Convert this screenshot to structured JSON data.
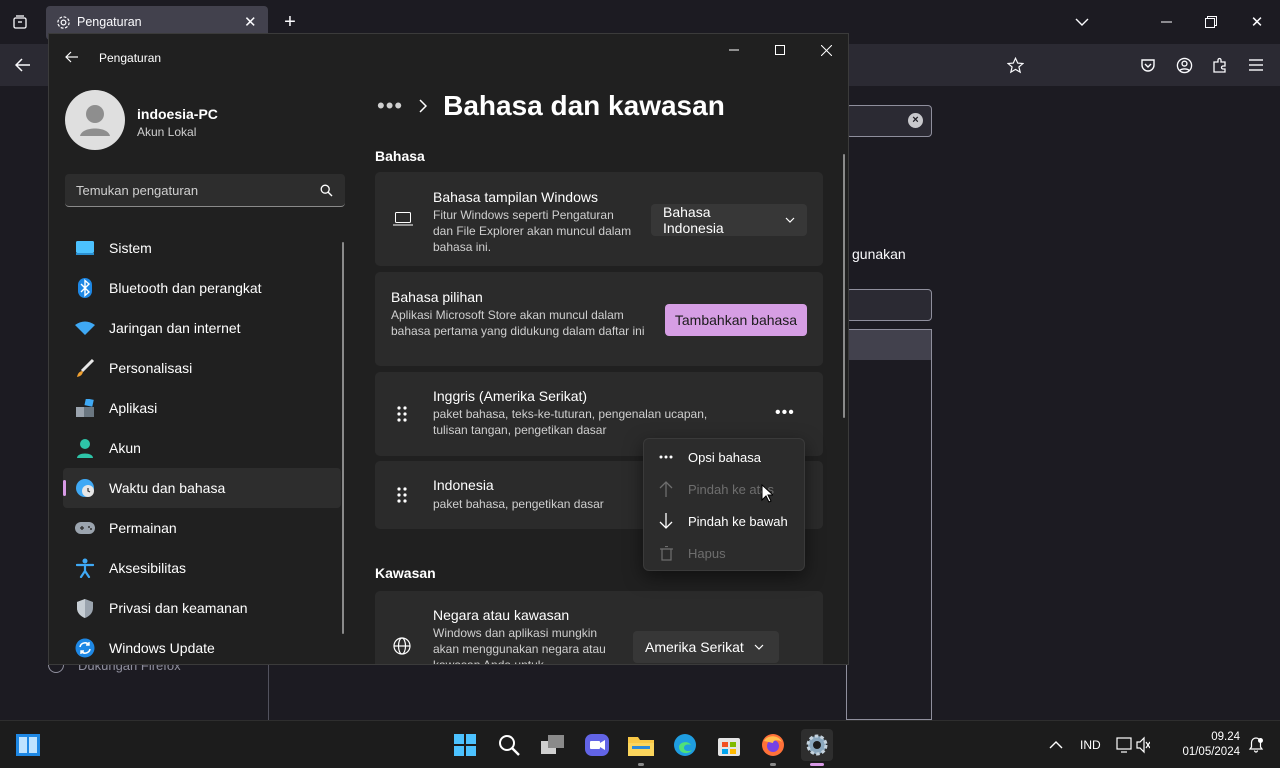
{
  "firefox": {
    "tab_title": "Pengaturan",
    "background_text": "gunakan",
    "support_link": "Dukungan Firefox"
  },
  "settings": {
    "window_title": "Pengaturan",
    "profile": {
      "name": "indoesia-PC",
      "account_type": "Akun Lokal"
    },
    "search": {
      "placeholder": "Temukan pengaturan"
    },
    "nav": [
      {
        "label": "Sistem",
        "icon": "monitor-icon"
      },
      {
        "label": "Bluetooth dan perangkat",
        "icon": "bluetooth-icon"
      },
      {
        "label": "Jaringan dan internet",
        "icon": "wifi-icon"
      },
      {
        "label": "Personalisasi",
        "icon": "brush-icon"
      },
      {
        "label": "Aplikasi",
        "icon": "apps-icon"
      },
      {
        "label": "Akun",
        "icon": "person-icon"
      },
      {
        "label": "Waktu dan bahasa",
        "icon": "globe-clock-icon",
        "selected": true
      },
      {
        "label": "Permainan",
        "icon": "gamepad-icon"
      },
      {
        "label": "Aksesibilitas",
        "icon": "accessibility-icon"
      },
      {
        "label": "Privasi dan keamanan",
        "icon": "shield-icon"
      },
      {
        "label": "Windows Update",
        "icon": "update-icon"
      }
    ],
    "breadcrumb_more": "•••",
    "page_title": "Bahasa dan kawasan",
    "section_language": "Bahasa",
    "display_language": {
      "title": "Bahasa tampilan Windows",
      "desc": "Fitur Windows seperti Pengaturan dan File Explorer akan muncul dalam bahasa ini.",
      "value": "Bahasa Indonesia"
    },
    "preferred_languages": {
      "title": "Bahasa pilihan",
      "desc": "Aplikasi Microsoft Store akan muncul dalam bahasa pertama yang didukung dalam daftar ini",
      "button": "Tambahkan bahasa"
    },
    "languages": [
      {
        "name": "Inggris (Amerika Serikat)",
        "features": "paket bahasa, teks-ke-tuturan, pengenalan ucapan, tulisan tangan, pengetikan dasar",
        "more": "•••"
      },
      {
        "name": "Indonesia",
        "features": "paket bahasa, pengetikan dasar"
      }
    ],
    "context_menu": [
      {
        "label": "Opsi bahasa",
        "icon": "more-icon",
        "enabled": true
      },
      {
        "label": "Pindah ke atas",
        "icon": "arrow-up-icon",
        "enabled": false
      },
      {
        "label": "Pindah ke bawah",
        "icon": "arrow-down-icon",
        "enabled": true
      },
      {
        "label": "Hapus",
        "icon": "trash-icon",
        "enabled": false
      }
    ],
    "section_region": "Kawasan",
    "region": {
      "title": "Negara atau kawasan",
      "desc": "Windows dan aplikasi mungkin akan menggunakan negara atau kawasan Anda untuk",
      "value": "Amerika Serikat"
    },
    "accent_color": "#d69ee4"
  },
  "taskbar": {
    "input_indicator": "IND",
    "time": "09.24",
    "date": "01/05/2024"
  }
}
